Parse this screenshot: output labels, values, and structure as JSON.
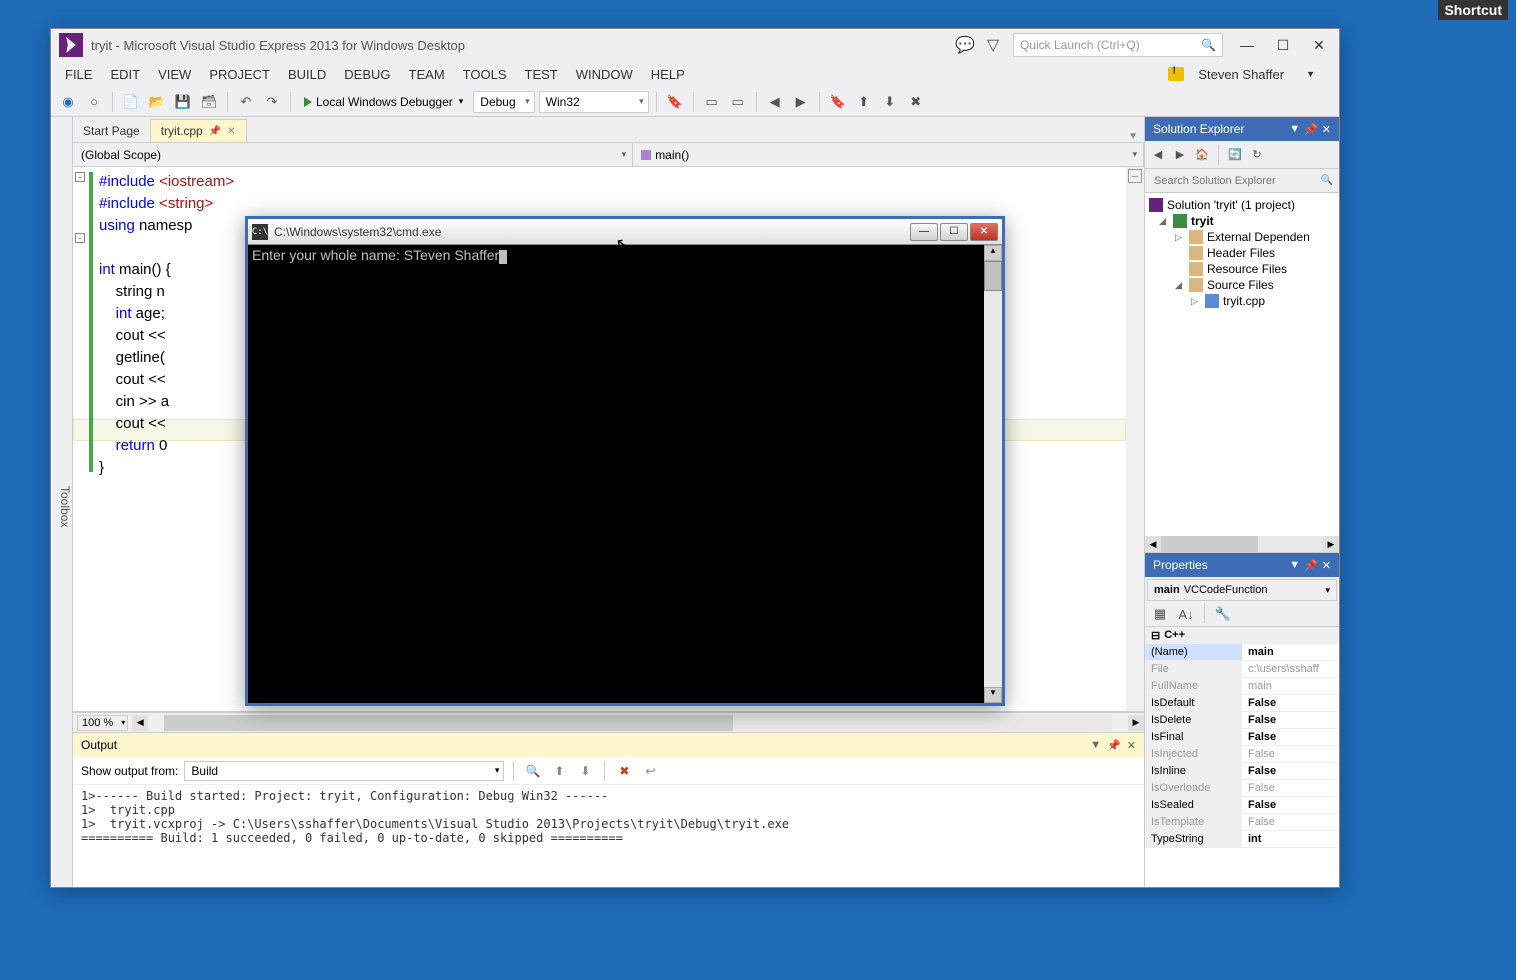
{
  "shortcut_label": "Shortcut",
  "titlebar": {
    "text": "tryit - Microsoft Visual Studio Express 2013 for Windows Desktop"
  },
  "quick_launch_placeholder": "Quick Launch (Ctrl+Q)",
  "user_name": "Steven Shaffer",
  "menu": [
    "FILE",
    "EDIT",
    "VIEW",
    "PROJECT",
    "BUILD",
    "DEBUG",
    "TEAM",
    "TOOLS",
    "TEST",
    "WINDOW",
    "HELP"
  ],
  "toolbar": {
    "run_label": "Local Windows Debugger",
    "config": "Debug",
    "platform": "Win32"
  },
  "tabs": {
    "start": "Start Page",
    "active": "tryit.cpp"
  },
  "nav": {
    "scope": "(Global Scope)",
    "func": "main()"
  },
  "code_lines": [
    {
      "t": "#include <iostream>",
      "pre": true
    },
    {
      "t": "#include <string>",
      "pre": true
    },
    {
      "t": "using namesp",
      "kw": [
        "using"
      ]
    },
    {
      "t": ""
    },
    {
      "t": "int main() {",
      "kw": [
        "int"
      ]
    },
    {
      "t": "    string n",
      "kw": [
        "string"
      ],
      "ind": 1
    },
    {
      "t": "    int age;",
      "kw": [
        "int"
      ],
      "ind": 1
    },
    {
      "t": "    cout << ",
      "ind": 1
    },
    {
      "t": "    getline(",
      "ind": 1
    },
    {
      "t": "    cout << ",
      "ind": 1
    },
    {
      "t": "    cin >> a",
      "ind": 1
    },
    {
      "t": "    cout << ",
      "ind": 1
    },
    {
      "t": "    return 0",
      "kw": [
        "return"
      ],
      "ind": 1
    },
    {
      "t": "}"
    }
  ],
  "zoom": "100 %",
  "output": {
    "title": "Output",
    "from_label": "Show output from:",
    "from_value": "Build",
    "text": "1>------ Build started: Project: tryit, Configuration: Debug Win32 ------\n1>  tryit.cpp\n1>  tryit.vcxproj -> C:\\Users\\sshaffer\\Documents\\Visual Studio 2013\\Projects\\tryit\\Debug\\tryit.exe\n========== Build: 1 succeeded, 0 failed, 0 up-to-date, 0 skipped =========="
  },
  "solution_explorer": {
    "title": "Solution Explorer",
    "search_placeholder": "Search Solution Explorer",
    "sln": "Solution 'tryit' (1 project)",
    "proj": "tryit",
    "folders": [
      "External Dependen",
      "Header Files",
      "Resource Files",
      "Source Files"
    ],
    "file": "tryit.cpp"
  },
  "properties": {
    "title": "Properties",
    "obj_name": "main",
    "obj_type": "VCCodeFunction",
    "category": "C++",
    "rows": [
      {
        "n": "(Name)",
        "v": "main",
        "sel": true
      },
      {
        "n": "File",
        "v": "c:\\users\\sshaff",
        "dis": true
      },
      {
        "n": "FullName",
        "v": "main",
        "dis": true
      },
      {
        "n": "IsDefault",
        "v": "False"
      },
      {
        "n": "IsDelete",
        "v": "False"
      },
      {
        "n": "IsFinal",
        "v": "False"
      },
      {
        "n": "IsInjected",
        "v": "False",
        "dis": true
      },
      {
        "n": "IsInline",
        "v": "False"
      },
      {
        "n": "IsOverloade",
        "v": "False",
        "dis": true
      },
      {
        "n": "IsSealed",
        "v": "False"
      },
      {
        "n": "IsTemplate",
        "v": "False",
        "dis": true
      },
      {
        "n": "TypeString",
        "v": "int"
      }
    ]
  },
  "console": {
    "title": "C:\\Windows\\system32\\cmd.exe",
    "prompt": "Enter your whole name: ",
    "input": "STeven Shaffer"
  },
  "toolbox_label": "Toolbox"
}
